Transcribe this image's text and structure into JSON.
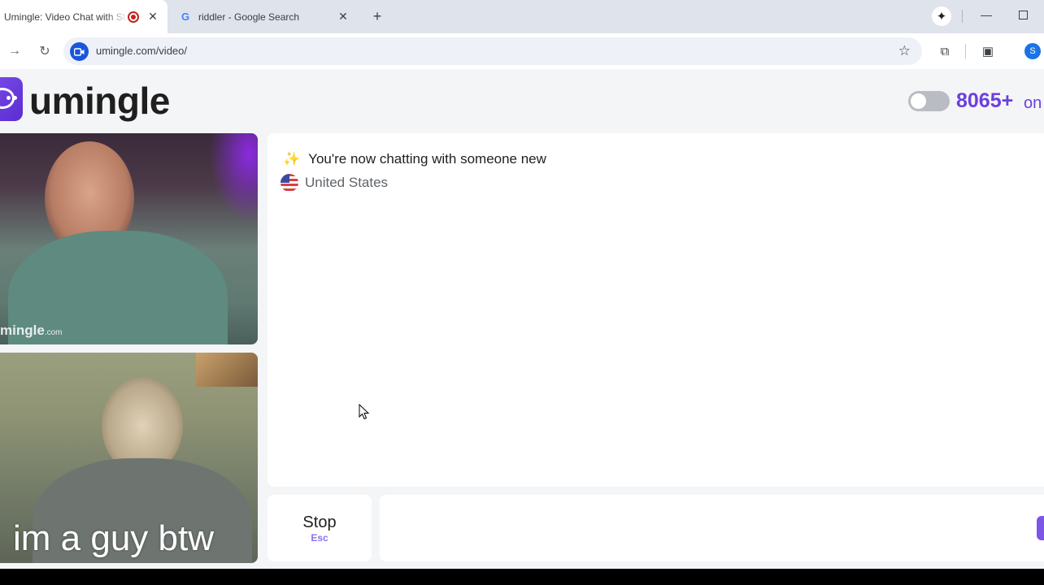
{
  "browser": {
    "tabs": [
      {
        "title": "Umingle: Video Chat with Stra",
        "active": true,
        "recording": true
      },
      {
        "title": "riddler - Google Search",
        "active": false
      }
    ],
    "url": "umingle.com/video/",
    "profile_initial": "S"
  },
  "site": {
    "logo_text": "umingle",
    "online_count": "8065+",
    "online_suffix": "on",
    "accent_color": "#6a3fe0"
  },
  "videos": {
    "remote_watermark": "mingle",
    "remote_watermark_suffix": ".com",
    "local_caption": "im a guy btw"
  },
  "chat": {
    "status_message": "You're now chatting with someone new",
    "status_icon": "sparkle-icon",
    "country": "United States",
    "country_icon": "us-flag-icon"
  },
  "controls": {
    "stop_label": "Stop",
    "stop_shortcut": "Esc"
  }
}
